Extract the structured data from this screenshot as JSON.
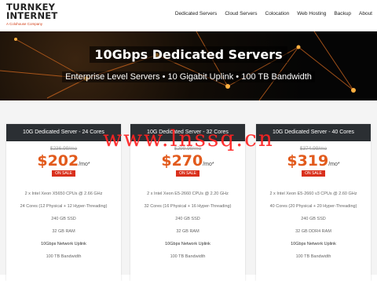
{
  "brand": {
    "line1": "TURNKEY",
    "line2": "INTERNET",
    "tagline": "A Colohouse Company"
  },
  "nav": {
    "items": [
      "Dedicated Servers",
      "Cloud Servers",
      "Colocation",
      "Web Hosting",
      "Backup",
      "About"
    ]
  },
  "hero": {
    "title": "10Gbps Dedicated Servers",
    "subtitle": "Enterprise Level Servers  •  10 Gigabit Uplink  •  100 TB Bandwidth"
  },
  "plans": [
    {
      "title": "10G Dedicated Server - 24 Cores",
      "old_price": "$236.99/mo",
      "price": "$202",
      "per": "/mo*",
      "badge": "ON SALE",
      "specs": [
        "2 x Intel Xeon X5650 CPUs @ 2.66 GHz",
        "24 Cores (12 Physical + 12 Hyper-Threading)",
        "240 GB SSD",
        "32 GB RAM",
        "10Gbps Network Uplink",
        "100 TB Bandwidth"
      ]
    },
    {
      "title": "10G Dedicated Server - 32 Cores",
      "old_price": "$299.99/mo",
      "price": "$270",
      "per": "/mo*",
      "badge": "ON SALE",
      "specs": [
        "2 x Intel Xeon E5-2660 CPUs @ 2.20 GHz",
        "32 Cores (16 Physical + 16 Hyper-Threading)",
        "240 GB SSD",
        "32 GB RAM",
        "10Gbps Network Uplink",
        "100 TB Bandwidth"
      ]
    },
    {
      "title": "10G Dedicated Server - 40 Cores",
      "old_price": "$374.99/mo",
      "price": "$319",
      "per": "/mo*",
      "badge": "ON SALE",
      "specs": [
        "2 x Intel Xeon E5-2660 v3 CPUs @ 2.60 GHz",
        "40 Cores (20 Physical + 20 Hyper-Threading)",
        "240 GB SSD",
        "32 GB DDR4 RAM",
        "10Gbps Network Uplink",
        "100 TB Bandwidth"
      ]
    }
  ],
  "watermark": "www.lnssq.cn",
  "colors": {
    "accent": "#e25a1c",
    "badge": "#d9301c",
    "card_header": "#2b2f33",
    "watermark": "#ff2222"
  }
}
